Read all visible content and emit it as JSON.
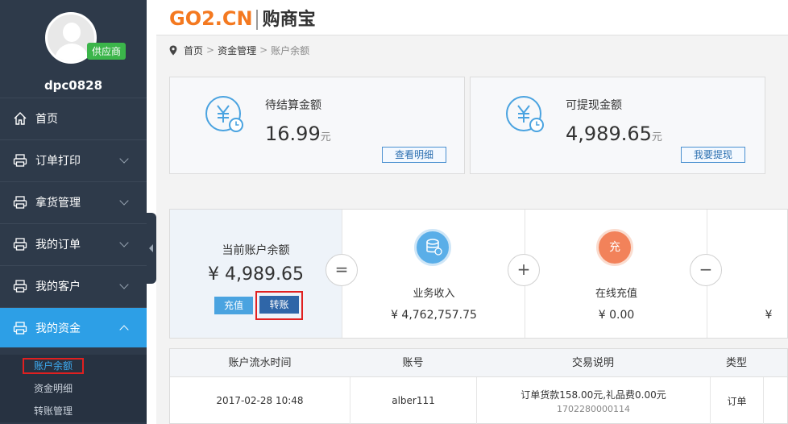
{
  "sidebar": {
    "badge": "供应商",
    "username": "dpc0828",
    "items": [
      {
        "label": "首页"
      },
      {
        "label": "订单打印"
      },
      {
        "label": "拿货管理"
      },
      {
        "label": "我的订单"
      },
      {
        "label": "我的客户"
      },
      {
        "label": "我的资金"
      }
    ],
    "sub_items": [
      {
        "label": "账户余额"
      },
      {
        "label": "资金明细"
      },
      {
        "label": "转账管理"
      }
    ]
  },
  "header": {
    "logo_en": "GO2.CN",
    "logo_cn": "购商宝"
  },
  "breadcrumb": [
    "首页",
    "资金管理",
    "账户余额"
  ],
  "cards": {
    "pending": {
      "label": "待结算金额",
      "amount": "16.99",
      "unit": "元",
      "button": "查看明细"
    },
    "withdrawable": {
      "label": "可提现金额",
      "amount": "4,989.65",
      "unit": "元",
      "button": "我要提现"
    }
  },
  "summary": {
    "current_label": "当前账户余额",
    "current_value": "¥ 4,989.65",
    "recharge_btn": "充值",
    "transfer_btn": "转账",
    "op_equals": "=",
    "op_plus": "+",
    "op_minus": "−",
    "income_label": "业务收入",
    "income_value": "¥  4,762,757.75",
    "online_label": "在线充值",
    "online_value": "¥  0.00",
    "online_icon_text": "充",
    "partial_value": "¥"
  },
  "table": {
    "headers": [
      "账户流水时间",
      "账号",
      "交易说明",
      "类型"
    ],
    "rows": [
      {
        "time": "2017-02-28 10:48",
        "account": "alber111",
        "desc": "订单货款158.00元,礼品费0.00元",
        "desc_sub": "1702280000114",
        "type": "订单"
      }
    ]
  },
  "colors": {
    "sidebar_bg": "#2e3a4a",
    "active_blue": "#2d9fe6",
    "logo_orange": "#f47920",
    "badge_green": "#3bb54a",
    "highlight_red": "#e02020"
  }
}
